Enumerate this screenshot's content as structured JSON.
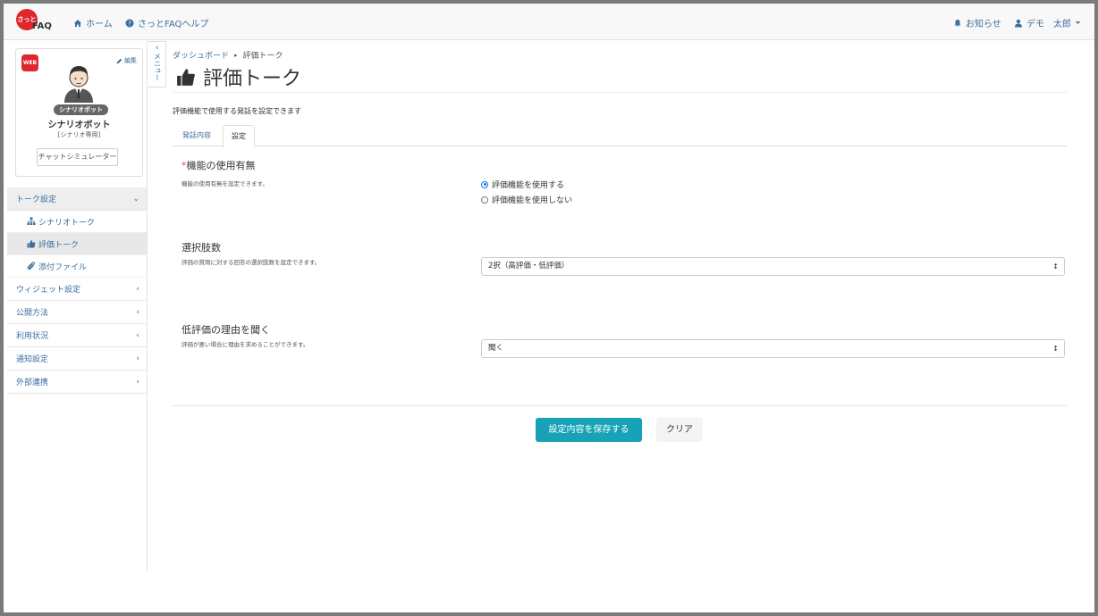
{
  "header": {
    "logo_mark": "さっと",
    "logo_text": "FAQ",
    "home": "ホーム",
    "help": "さっとFAQヘルプ",
    "notice": "お知らせ",
    "user": "デモ　太郎"
  },
  "profile": {
    "web_badge": "WEB",
    "edit": "編集",
    "badge": "シナリオボット",
    "name": "シナリオボット",
    "sub": "[シナリオ専用]",
    "simulator": "チャットシミュレーター"
  },
  "menu_toggle": "メニュー",
  "menu": {
    "talk_settings": "トーク設定",
    "scenario_talk": "シナリオトーク",
    "rating_talk": "評価トーク",
    "attachments": "添付ファイル",
    "widget_settings": "ウィジェット設定",
    "publish": "公開方法",
    "usage": "利用状況",
    "notifications": "通知設定",
    "integrations": "外部連携"
  },
  "breadcrumb": {
    "dashboard": "ダッシュボード",
    "current": "評価トーク"
  },
  "page_title": "評価トーク",
  "description": "評価機能で使用する発話を設定できます",
  "tabs": {
    "content": "発話内容",
    "settings": "設定"
  },
  "settings": {
    "feature": {
      "required_mark": "*",
      "label": "機能の使用有無",
      "help": "機能の使用有無を設定できます。",
      "options": [
        "評価機能を使用する",
        "評価機能を使用しない"
      ],
      "selected_index": 0
    },
    "choices": {
      "label": "選択肢数",
      "help": "評価の質問に対する回答の選択肢数を設定できます。",
      "value": "2択（高評価・低評価）"
    },
    "reason": {
      "label": "低評価の理由を聞く",
      "help": "評価が悪い場合に理由を求めることができます。",
      "value": "聞く"
    }
  },
  "buttons": {
    "save": "設定内容を保存する",
    "clear": "クリア"
  },
  "colors": {
    "accent": "#17a2b8",
    "link": "#3c6e9e",
    "brand": "#e0262e"
  }
}
